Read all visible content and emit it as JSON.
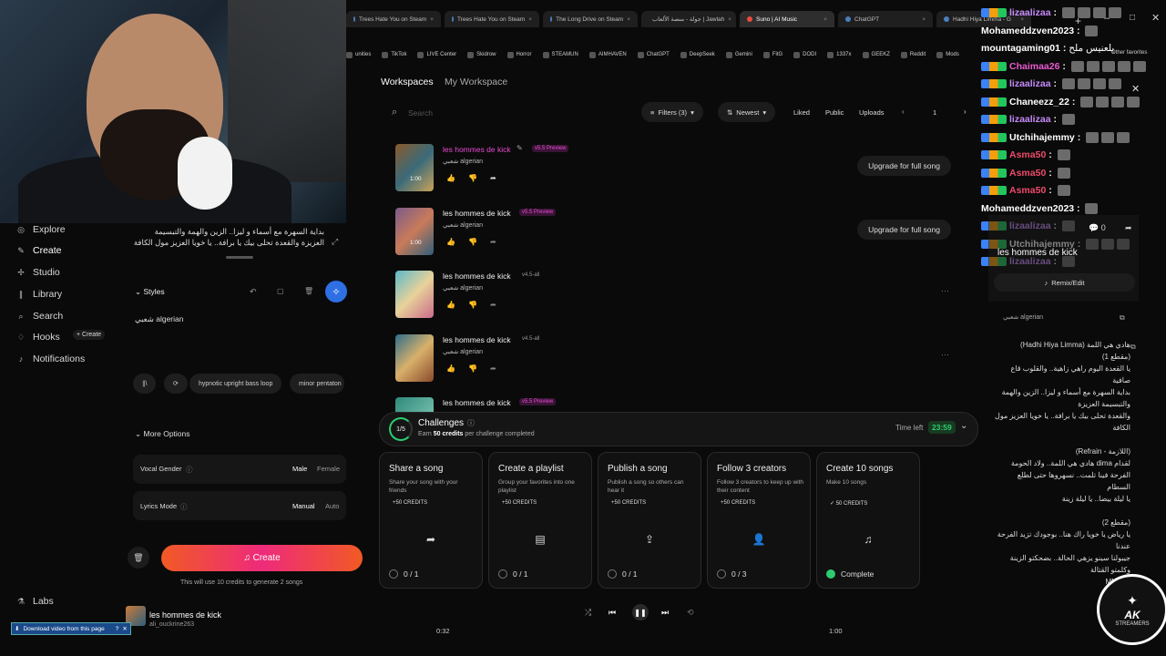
{
  "browser": {
    "tabs": [
      "Trees Hate You on Steam",
      "Trees Hate You on Steam",
      "The Long Drive on Steam",
      "جولة - منصة الألعاب | Jawlah",
      "Suno | AI Music",
      "ChatGPT",
      "Hadhi Hiya Limma - G"
    ],
    "active_tab": 4,
    "bookmarks": [
      "unities",
      "TikTok",
      "LIVE Center",
      "Skidrow",
      "Horror",
      "STEAMUN",
      "AIMHAVEN",
      "ChatGPT",
      "DeepSeek",
      "Gemini",
      "FitG",
      "DODI",
      "1337x",
      "GEEKZ",
      "Reddit",
      "Mods"
    ],
    "other_bookmarks": "Other favorites"
  },
  "sidebar": {
    "items": [
      {
        "label": "Explore",
        "icon": "compass-icon"
      },
      {
        "label": "Create",
        "icon": "pencil-icon"
      },
      {
        "label": "Studio",
        "icon": "studio-icon"
      },
      {
        "label": "Library",
        "icon": "library-icon"
      },
      {
        "label": "Search",
        "icon": "search-icon"
      },
      {
        "label": "Hooks",
        "icon": "hook-icon"
      },
      {
        "label": "Notifications",
        "icon": "bell-icon"
      }
    ],
    "hooks_create": "+ Create",
    "labs": "Labs"
  },
  "create": {
    "lyrics": "بداية السهرة مع أسماء و ليزا.. الزين والهمة والتبسيمة العزيزة والقعدة تحلى بيك يا برافة.. يا خويا العزيز مول الكافة",
    "styles_label": "Styles",
    "styles_value": "شعبي algerian",
    "suggestions": [
      "hypnotic upright bass loop",
      "minor pentaton"
    ],
    "more_options": "More Options",
    "vocal_gender_label": "Vocal Gender",
    "vocal_gender_options": [
      "Male",
      "Female"
    ],
    "lyrics_mode_label": "Lyrics Mode",
    "lyrics_mode_options": [
      "Manual",
      "Auto"
    ],
    "create_button": "Create",
    "credits_note": "This will use 10 credits to generate 2 songs"
  },
  "workspace": {
    "breadcrumb_root": "Workspaces",
    "breadcrumb_current": "My Workspace",
    "search_placeholder": "Search",
    "filters": "Filters (3)",
    "sort": "Newest",
    "liked": "Liked",
    "public": "Public",
    "uploads": "Uploads",
    "page": "1"
  },
  "songs": [
    {
      "title": "les hommes de kick",
      "tag": "v5.5 Preview",
      "genre": "شعبي algerian",
      "duration": "1:00",
      "upgrade": "Upgrade for full song"
    },
    {
      "title": "les hommes de kick",
      "tag": "v5.5 Preview",
      "genre": "شعبي algerian",
      "duration": "1:00",
      "upgrade": "Upgrade for full song"
    },
    {
      "title": "les hommes de kick",
      "tag": "v4.5-all",
      "genre": "شعبي algerian",
      "duration": "",
      "upgrade": ""
    },
    {
      "title": "les hommes de kick",
      "tag": "v4.5-all",
      "genre": "شعبي algerian",
      "duration": "",
      "upgrade": ""
    },
    {
      "title": "les hommes de kick",
      "tag": "v5.5 Preview",
      "genre": "",
      "duration": "",
      "upgrade": ""
    }
  ],
  "challenges": {
    "progress": "1/5",
    "title": "Challenges",
    "subtitle_prefix": "Earn",
    "subtitle_bold": "50 credits",
    "subtitle_suffix": "per challenge completed",
    "time_left_label": "Time left",
    "time_left": "23:59",
    "cards": [
      {
        "title": "Share a song",
        "desc": "Share your song with your friends",
        "credits": "+50 CREDITS",
        "progress": "0 / 1",
        "icon": "share-icon",
        "glyph": "➦"
      },
      {
        "title": "Create a playlist",
        "desc": "Group your favorites into one playlist",
        "credits": "+50 CREDITS",
        "progress": "0 / 1",
        "icon": "playlist-icon",
        "glyph": "▤"
      },
      {
        "title": "Publish a song",
        "desc": "Publish a song so others can hear it",
        "credits": "+50 CREDITS",
        "progress": "0 / 1",
        "icon": "upload-icon",
        "glyph": "⇪"
      },
      {
        "title": "Follow 3 creators",
        "desc": "Follow 3 creators to keep up with their content",
        "credits": "+50 CREDITS",
        "progress": "0 / 3",
        "icon": "follow-icon",
        "glyph": "👤"
      },
      {
        "title": "Create 10 songs",
        "desc": "Make 10 songs",
        "credits": "✓ 50 CREDITS",
        "progress": "Complete",
        "icon": "music-note-icon",
        "glyph": "♫"
      }
    ]
  },
  "player": {
    "title": "les hommes de kick",
    "artist": "ali_ouckrine263",
    "elapsed": "0:32",
    "total": "1:00"
  },
  "chat": [
    {
      "user": "lizaalizaa",
      "color": "#c58af9",
      "emotes": 4
    },
    {
      "user": "Mohameddzven2023",
      "color": "#ffffff",
      "emotes": 1
    },
    {
      "user": "mountagaming01",
      "color": "#ffffff",
      "text": "يلعنيس ملح",
      "emotes": 0
    },
    {
      "user": "Chaimaa26",
      "color": "#e95ad1",
      "emotes": 5
    },
    {
      "user": "lizaalizaa",
      "color": "#c58af9",
      "emotes": 4
    },
    {
      "user": "Chaneezz_22",
      "color": "#ffffff",
      "emotes": 4
    },
    {
      "user": "lizaalizaa",
      "color": "#c58af9",
      "emotes": 1
    },
    {
      "user": "Utchihajemmy",
      "color": "#ffffff",
      "emotes": 3
    },
    {
      "user": "Asma50",
      "color": "#ee4b6a",
      "emotes": 1
    },
    {
      "user": "Asma50",
      "color": "#ee4b6a",
      "emotes": 1
    },
    {
      "user": "Asma50",
      "color": "#ee4b6a",
      "emotes": 1
    },
    {
      "user": "Mohameddzven2023",
      "color": "#ffffff",
      "emotes": 1
    },
    {
      "user": "lizaalizaa",
      "color": "#c58af9",
      "emotes": 1
    },
    {
      "user": "Utchihajemmy",
      "color": "#ffffff",
      "emotes": 3
    },
    {
      "user": "lizaalizaa",
      "color": "#c58af9",
      "emotes": 1
    }
  ],
  "song_panel": {
    "title": "les hommes de kick",
    "comments": "0",
    "remix": "Remix/Edit",
    "genre": "شعبي algerian",
    "lyrics": "هادي هي اللمة (Hadhi Hiya Limma)\n(مقطع 1)\nيا القعدة اليوم راهي زاهية.. والقلوب قاع صافية\nبداية السهرة مع أسماء و ليزا.. الزين والهمة والتبسيمة العزيزة\nوالقعدة تحلى بيك يا برافة.. يا خويا العزيز مول الكافة\n\n(اللازمة - Refrain)\nلقدام dima هادي هي اللمة.. ولاد الحومة\nالفرحة فينا تلمت.. نسهروها حتى لطلع السطام\nيا ليلة بيضا.. يا ليلة زينة\n\n(مقطع 2)\nيا رياض يا خويا راك هنا.. بوجودك تزيد الفرحة عندنا\nجيبولنا سينو يزهي الحالة.. بضحكتو الزينة وكلمتو القتالة\n... MMA"
  },
  "overlay": {
    "download": "Download video from this page",
    "logo_line1": "AK",
    "logo_line2": "STREAMERS"
  }
}
